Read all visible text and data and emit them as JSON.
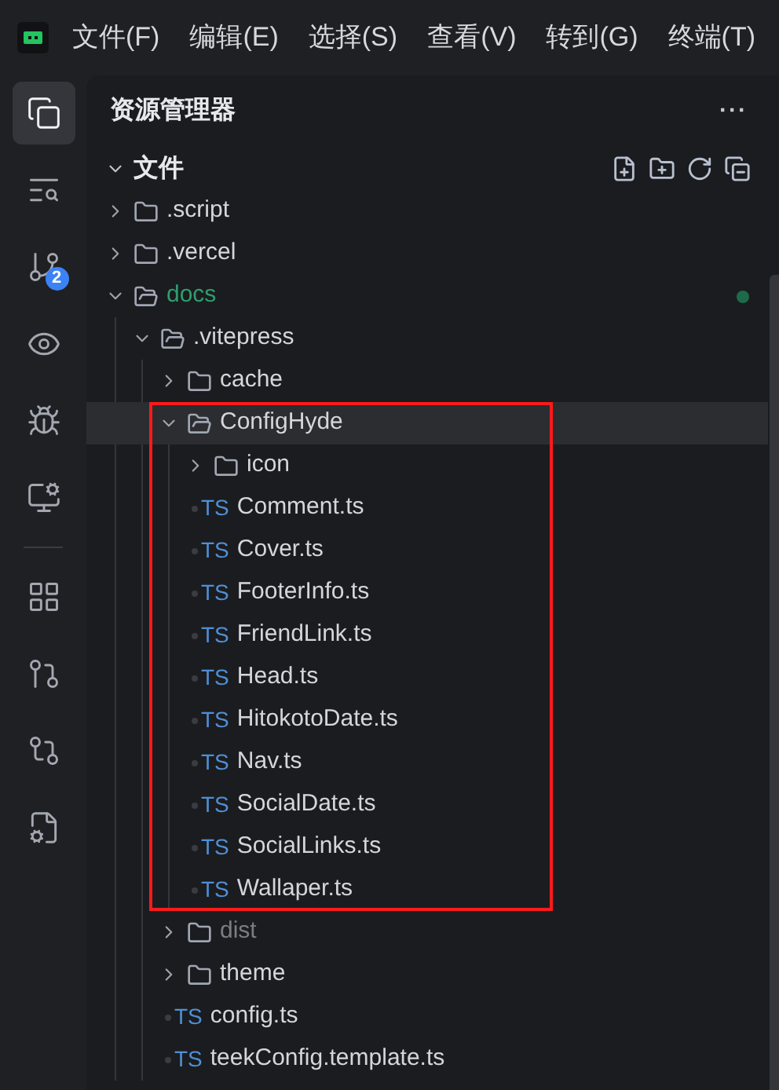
{
  "menu": [
    "文件(F)",
    "编辑(E)",
    "选择(S)",
    "查看(V)",
    "转到(G)",
    "终端(T)"
  ],
  "activity": [
    {
      "kind": "button",
      "selected": true
    },
    {
      "kind": "button",
      "selected": false
    },
    {
      "kind": "button",
      "selected": false,
      "badge": "2"
    },
    {
      "kind": "button",
      "selected": false
    },
    {
      "kind": "button",
      "selected": false
    },
    {
      "kind": "button",
      "selected": false
    },
    {
      "kind": "divider"
    },
    {
      "kind": "button",
      "selected": false
    },
    {
      "kind": "button",
      "selected": false
    },
    {
      "kind": "button",
      "selected": false
    },
    {
      "kind": "button",
      "selected": false
    }
  ],
  "explorer": {
    "title": "资源管理器",
    "more": "···",
    "section": {
      "label": "文件",
      "expanded": true
    },
    "tree": [
      {
        "kind": "folder",
        "name": ".script",
        "expanded": false,
        "selected": false,
        "modified": false,
        "dimmed": false
      },
      {
        "kind": "folder",
        "name": ".vercel",
        "expanded": false,
        "selected": false,
        "modified": false,
        "dimmed": false
      },
      {
        "kind": "folder",
        "name": "docs",
        "expanded": true,
        "selected": false,
        "modified": true,
        "dimmed": false,
        "children": [
          {
            "kind": "folder",
            "name": ".vitepress",
            "expanded": true,
            "selected": false,
            "modified": false,
            "dimmed": false,
            "children": [
              {
                "kind": "folder",
                "name": "cache",
                "expanded": false,
                "selected": false,
                "modified": false,
                "dimmed": false
              },
              {
                "kind": "folder",
                "name": "ConfigHyde",
                "expanded": true,
                "selected": true,
                "modified": false,
                "dimmed": false,
                "highlighted": true,
                "children": [
                  {
                    "kind": "folder",
                    "name": "icon",
                    "expanded": false,
                    "selected": false,
                    "modified": false,
                    "dimmed": false
                  },
                  {
                    "kind": "ts",
                    "badge": "TS",
                    "name": "Comment.ts",
                    "selected": false,
                    "modified": false,
                    "dimmed": false
                  },
                  {
                    "kind": "ts",
                    "badge": "TS",
                    "name": "Cover.ts",
                    "selected": false,
                    "modified": false,
                    "dimmed": false
                  },
                  {
                    "kind": "ts",
                    "badge": "TS",
                    "name": "FooterInfo.ts",
                    "selected": false,
                    "modified": false,
                    "dimmed": false
                  },
                  {
                    "kind": "ts",
                    "badge": "TS",
                    "name": "FriendLink.ts",
                    "selected": false,
                    "modified": false,
                    "dimmed": false
                  },
                  {
                    "kind": "ts",
                    "badge": "TS",
                    "name": "Head.ts",
                    "selected": false,
                    "modified": false,
                    "dimmed": false
                  },
                  {
                    "kind": "ts",
                    "badge": "TS",
                    "name": "HitokotoDate.ts",
                    "selected": false,
                    "modified": false,
                    "dimmed": false
                  },
                  {
                    "kind": "ts",
                    "badge": "TS",
                    "name": "Nav.ts",
                    "selected": false,
                    "modified": false,
                    "dimmed": false
                  },
                  {
                    "kind": "ts",
                    "badge": "TS",
                    "name": "SocialDate.ts",
                    "selected": false,
                    "modified": false,
                    "dimmed": false
                  },
                  {
                    "kind": "ts",
                    "badge": "TS",
                    "name": "SocialLinks.ts",
                    "selected": false,
                    "modified": false,
                    "dimmed": false
                  },
                  {
                    "kind": "ts",
                    "badge": "TS",
                    "name": "Wallaper.ts",
                    "selected": false,
                    "modified": false,
                    "dimmed": false
                  }
                ]
              },
              {
                "kind": "folder",
                "name": "dist",
                "expanded": false,
                "selected": false,
                "modified": false,
                "dimmed": true
              },
              {
                "kind": "folder",
                "name": "theme",
                "expanded": false,
                "selected": false,
                "modified": false,
                "dimmed": false
              },
              {
                "kind": "ts",
                "badge": "TS",
                "name": "config.ts",
                "selected": false,
                "modified": false,
                "dimmed": false
              },
              {
                "kind": "ts",
                "badge": "TS",
                "name": "teekConfig.template.ts",
                "selected": false,
                "modified": false,
                "dimmed": false
              }
            ]
          }
        ]
      }
    ]
  }
}
